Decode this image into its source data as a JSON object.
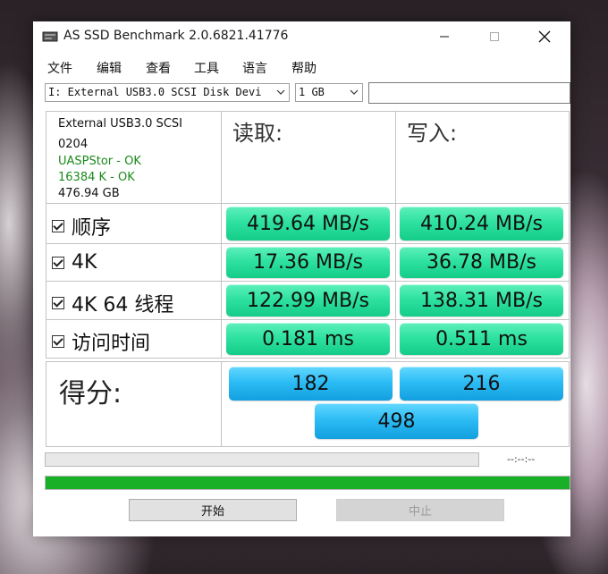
{
  "window": {
    "title": "AS SSD Benchmark 2.0.6821.41776"
  },
  "menu": [
    "文件",
    "编辑",
    "查看",
    "工具",
    "语言",
    "帮助"
  ],
  "selectors": {
    "drive": "I: External USB3.0 SCSI Disk Devi",
    "size": "1 GB"
  },
  "drive_info": {
    "name": "External USB3.0 SCSI",
    "firmware": "0204",
    "driver_status": "UASPStor - OK",
    "alignment_status": "16384 K - OK",
    "capacity": "476.94 GB"
  },
  "columns": {
    "read": "读取:",
    "write": "写入:"
  },
  "tests": [
    {
      "label": "顺序",
      "read": "419.64 MB/s",
      "write": "410.24 MB/s",
      "checked": true
    },
    {
      "label": "4K",
      "read": "17.36 MB/s",
      "write": "36.78 MB/s",
      "checked": true
    },
    {
      "label": "4K 64 线程",
      "read": "122.99 MB/s",
      "write": "138.31 MB/s",
      "checked": true
    },
    {
      "label": "访问时间",
      "read": "0.181 ms",
      "write": "0.511 ms",
      "checked": true
    }
  ],
  "score": {
    "label": "得分:",
    "read": "182",
    "write": "216",
    "total": "498"
  },
  "progress": {
    "time": "--:--:--",
    "top_fraction": 0,
    "bottom_fraction": 1
  },
  "buttons": {
    "start": "开始",
    "stop": "中止"
  },
  "colors": {
    "result_green": "#2fe2a1",
    "score_blue": "#2dbdf5",
    "ok_text": "#1b8a1b",
    "progress_fill": "#19b028"
  }
}
